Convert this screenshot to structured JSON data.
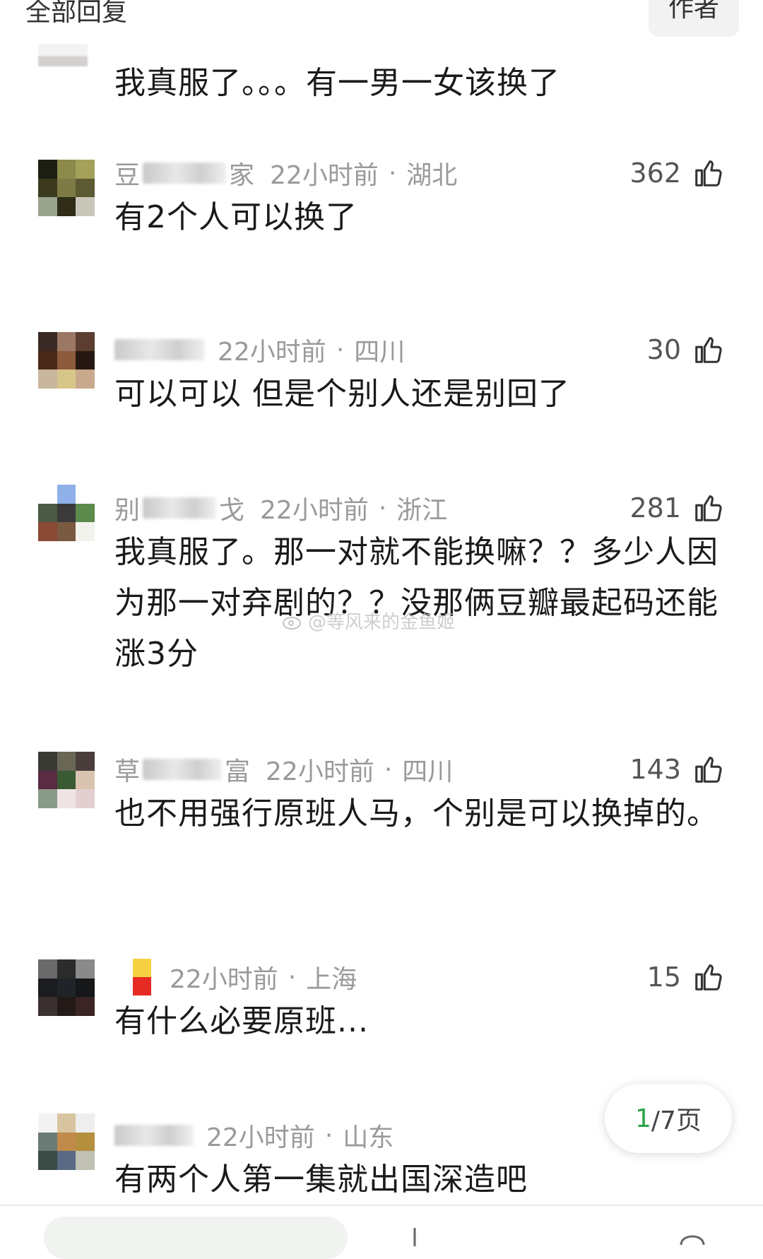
{
  "header": {
    "title": "全部回复",
    "author_tab": "作者"
  },
  "top_reply": {
    "text": "我真服了。。。有一男一女该换了"
  },
  "comments": [
    {
      "name_visible": [
        "豆",
        "家"
      ],
      "time": "22小时前",
      "location": "湖北",
      "likes": "362",
      "text": "有2个人可以换了"
    },
    {
      "name_visible": [],
      "time": "22小时前",
      "location": "四川",
      "likes": "30",
      "text": "可以可以 但是个别人还是别回了"
    },
    {
      "name_visible": [
        "别",
        "戈"
      ],
      "time": "22小时前",
      "location": "浙江",
      "likes": "281",
      "text": "我真服了。那一对就不能换嘛？？多少人因为那一对弃剧的？？没那俩豆瓣最起码还能涨3分"
    },
    {
      "name_visible": [
        "草",
        "富"
      ],
      "time": "22小时前",
      "location": "四川",
      "likes": "143",
      "text": "也不用强行原班人马，个别是可以换掉的。"
    },
    {
      "name_visible": [],
      "time": "22小时前",
      "location": "上海",
      "likes": "15",
      "text": "有什么必要原班..."
    },
    {
      "name_visible": [],
      "time": "22小时前",
      "location": "山东",
      "likes": "",
      "text": "有两个人第一集就出国深造吧"
    }
  ],
  "separator": "·",
  "watermark": {
    "text": "@等风来的金鱼姬",
    "icon": "weibo-icon"
  },
  "pager": {
    "current": "1",
    "total_text": "/7页"
  },
  "colors": {
    "accent_green": "#2aa34a",
    "meta_gray": "#9a9a9a"
  }
}
